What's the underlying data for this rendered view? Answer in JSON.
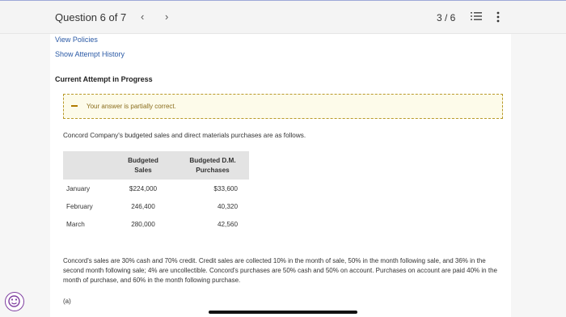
{
  "header": {
    "question_label": "Question 6 of 7",
    "prev_icon": "chevron-left-icon",
    "next_icon": "chevron-right-icon",
    "page_counter": "3 / 6",
    "list_icon": "list-icon",
    "more_icon": "more-vertical-icon"
  },
  "links": {
    "view_policies": "View Policies",
    "attempt_history": "Show Attempt History"
  },
  "attempt_title": "Current Attempt in Progress",
  "notice": {
    "text": "Your answer is partially correct.",
    "color": "#fdfbea",
    "border_color": "#b99a2a"
  },
  "intro": "Concord Company's budgeted sales and direct materials purchases are as follows.",
  "table": {
    "headers": [
      "",
      "Budgeted\nSales",
      "Budgeted D.M.\nPurchases"
    ],
    "header_sales_line1": "Budgeted",
    "header_sales_line2": "Sales",
    "header_dm_line1": "Budgeted D.M.",
    "header_dm_line2": "Purchases",
    "rows": [
      {
        "month": "January",
        "sales": "$224,000",
        "purchases": "$33,600"
      },
      {
        "month": "February",
        "sales": "246,400",
        "purchases": "40,320"
      },
      {
        "month": "March",
        "sales": "280,000",
        "purchases": "42,560"
      }
    ]
  },
  "paragraph": "Concord's sales are 30% cash and 70% credit. Credit sales are collected 10% in the month of sale, 50% in the month following sale, and 36% in the second month following sale; 4% are uncollectible. Concord's purchases are 50% cash and 50% on account. Purchases on account are paid 40% in the month of purchase, and 60% in the month following purchase.",
  "part_label": "(a)",
  "accessibility_icon": "accessibility-icon"
}
